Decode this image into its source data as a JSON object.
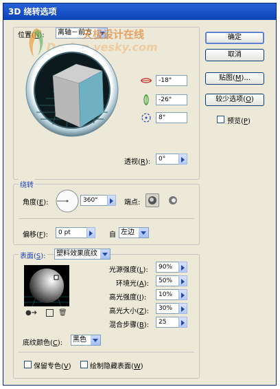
{
  "window": {
    "title": "3D 绕转选项"
  },
  "position": {
    "label": "位置(",
    "key": "N",
    "label_end": "):",
    "value": "离轴－前方",
    "rotate_x": "-18°",
    "rotate_y": "-26°",
    "rotate_z": "8°",
    "perspective_label": "透视(",
    "perspective_key": "R",
    "perspective_end": "):",
    "perspective_value": "0°"
  },
  "watermark": {
    "line1": "天极设计在线",
    "line2": "Design.yesky.com"
  },
  "buttons": {
    "ok": "确定",
    "cancel": "取消",
    "map_pre": "贴图(",
    "map_key": "M",
    "map_end": ")...",
    "fewer_pre": "较少选项(",
    "fewer_key": "O",
    "fewer_end": ")"
  },
  "preview": {
    "label_pre": "预览(",
    "key": "P",
    "label_end": ")"
  },
  "revolve": {
    "title": "绕转",
    "angle_pre": "角度(",
    "angle_key": "E",
    "angle_end": "):",
    "angle_value": "360°",
    "cap_label": "端点:",
    "offset_pre": "偏移(",
    "offset_key": "F",
    "offset_end": "):",
    "offset_value": "0 pt",
    "from_label": "自",
    "from_value": "左边"
  },
  "surface": {
    "label_pre": "表面(",
    "key": "S",
    "label_end": "):",
    "value": "塑料效果底纹",
    "rows": [
      {
        "pre": "光源强度(",
        "key": "L",
        "end": "):",
        "value": "90%"
      },
      {
        "pre": "环境光(",
        "key": "A",
        "end": "):",
        "value": "50%"
      },
      {
        "pre": "高光强度(",
        "key": "I",
        "end": "):",
        "value": "10%"
      },
      {
        "pre": "高光大小(",
        "key": "Z",
        "end": "):",
        "value": "30%"
      },
      {
        "pre": "混合步骤(",
        "key": "B",
        "end": "):",
        "value": "25"
      }
    ],
    "shade_pre": "底纹颜色(",
    "shade_key": "C",
    "shade_end": "):",
    "shade_value": "黑色",
    "preserve_pre": "保留专色(",
    "preserve_key": "V",
    "preserve_end": ")",
    "hidden_pre": "绘制隐藏表面(",
    "hidden_key": "W",
    "hidden_end": ")"
  },
  "colors": {
    "cube_front": "#6fb0c2",
    "cube_top": "#c9c9c9",
    "cube_side": "#9a9a9a",
    "title_blue": "#1d41b8"
  }
}
